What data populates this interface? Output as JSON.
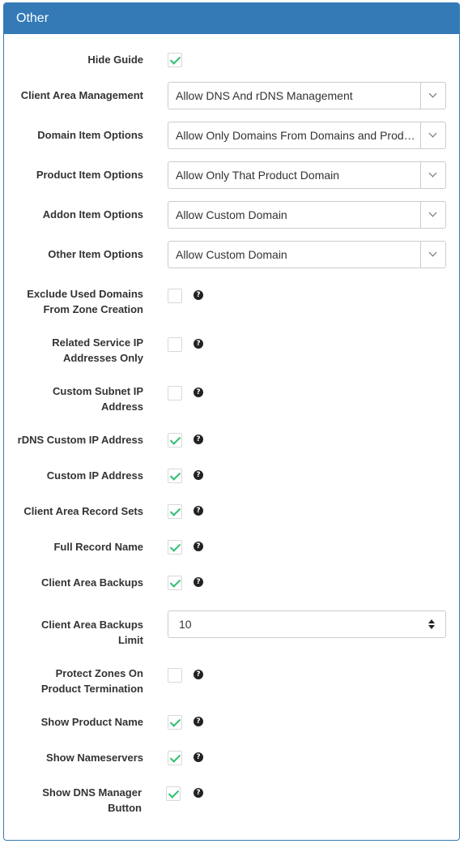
{
  "panel": {
    "title": "Other",
    "accent_color": "#337ab7",
    "check_color": "#2fbf71"
  },
  "fields": {
    "hide_guide": {
      "label": "Hide Guide",
      "checked": true
    },
    "client_area_management": {
      "label": "Client Area Management",
      "value": "Allow DNS And rDNS Management"
    },
    "domain_item_options": {
      "label": "Domain Item Options",
      "value": "Allow Only Domains From Domains and Products"
    },
    "product_item_options": {
      "label": "Product Item Options",
      "value": "Allow Only That Product Domain"
    },
    "addon_item_options": {
      "label": "Addon Item Options",
      "value": "Allow Custom Domain"
    },
    "other_item_options": {
      "label": "Other Item Options",
      "value": "Allow Custom Domain"
    },
    "exclude_used_domains": {
      "label_line1": "Exclude Used Domains",
      "label_line2": "From Zone Creation",
      "checked": false
    },
    "related_service_ip": {
      "label_line1": "Related Service IP",
      "label_line2": "Addresses Only",
      "checked": false
    },
    "custom_subnet_ip": {
      "label_line1": "Custom Subnet IP",
      "label_line2": "Address",
      "checked": false
    },
    "rdns_custom_ip": {
      "label": "rDNS Custom IP Address",
      "checked": true
    },
    "custom_ip_address": {
      "label": "Custom IP Address",
      "checked": true
    },
    "client_area_record_sets": {
      "label": "Client Area Record Sets",
      "checked": true
    },
    "full_record_name": {
      "label": "Full Record Name",
      "checked": true
    },
    "client_area_backups": {
      "label": "Client Area Backups",
      "checked": true
    },
    "client_area_backups_limit": {
      "label_line1": "Client Area Backups",
      "label_line2": "Limit",
      "value": "10"
    },
    "protect_zones": {
      "label_line1": "Protect Zones On",
      "label_line2": "Product Termination",
      "checked": false
    },
    "show_product_name": {
      "label": "Show Product Name",
      "checked": true
    },
    "show_nameservers": {
      "label": "Show Nameservers",
      "checked": true
    },
    "show_dns_manager_button": {
      "label_line1": "Show DNS Manager",
      "label_line2": "Button",
      "checked": true
    }
  },
  "help_icon_glyph": "?"
}
